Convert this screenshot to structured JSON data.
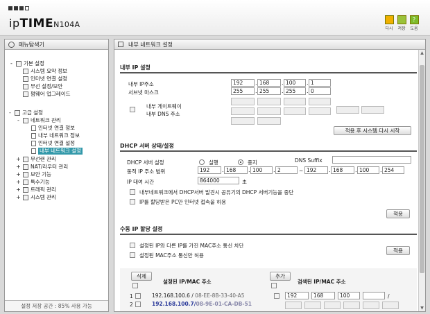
{
  "brand": {
    "prefix": "ip",
    "bold": "TIME",
    "model": "N104A"
  },
  "header_buttons": [
    {
      "label": "다시",
      "color": "#f0b000"
    },
    {
      "label": "저장",
      "color": "#9ac23a"
    },
    {
      "label": "도움",
      "color": "#7dbb2a"
    }
  ],
  "left_panel": {
    "title": "메뉴탐색기",
    "footer": "설정 저장 공간 : 85% 사용 가능",
    "tree": [
      {
        "label": "기본 설정",
        "pm": "-"
      },
      {
        "label": "시스템 요약 정보"
      },
      {
        "label": "인터넷 연결 설정"
      },
      {
        "label": "무선 설정/보안"
      },
      {
        "label": "펌웨어 업그레이드"
      },
      {
        "label": "고급 설정",
        "pm": "-"
      },
      {
        "label": "네트워크 관리",
        "pm": "-"
      },
      {
        "label": "인터넷 연결 정보"
      },
      {
        "label": "내부 네트워크 정보"
      },
      {
        "label": "인터넷 연결 설정"
      },
      {
        "label": "내부 네트워크 설정",
        "selected": true
      },
      {
        "label": "무선랜 관리",
        "pm": "+"
      },
      {
        "label": "NAT/라우터 관리",
        "pm": "+"
      },
      {
        "label": "보안 기능",
        "pm": "+"
      },
      {
        "label": "특수기능",
        "pm": "+"
      },
      {
        "label": "트래픽 관리",
        "pm": "+"
      },
      {
        "label": "시스템 관리",
        "pm": "+"
      }
    ]
  },
  "main": {
    "title": "내부 네트워크 설정",
    "ip": {
      "section": "내부 IP 설정",
      "ip_label": "내부 IP주소",
      "ip": [
        "192",
        "168",
        "100",
        "1"
      ],
      "mask_label": "서브넷 마스크",
      "mask": [
        "255",
        "255",
        "255",
        "0"
      ],
      "gw_label": "내부 게이트웨이",
      "dns_label": "내부 DNS 주소",
      "apply": "적용 후 시스템 다시 시작"
    },
    "dhcp": {
      "section": "DHCP 서버 상태/설정",
      "server_label": "DHCP 서버 설정",
      "run": "실행",
      "stop": "중지",
      "suffix_label": "DNS Suffix",
      "range_label": "동적 IP 주소 범위",
      "start": [
        "192",
        "168",
        "100",
        "2"
      ],
      "tilde": "~",
      "end": [
        "192",
        "168",
        "100",
        "254"
      ],
      "lease_label": "IP 대여 시간",
      "lease": "864000",
      "lease_unit": "초",
      "opt1": "내부네트워크에서 DHCP서버 발견시 공유기의 DHCP 서버기능을 중단",
      "opt2": "IP를 할당받은 PC만 인터넷 접속을 허용",
      "apply": "적용"
    },
    "manual": {
      "section": "수동 IP 할당 설정",
      "opt1": "설정된 IP와 다른 IP를 가진 MAC주소 통신 차단",
      "opt2": "설정된 MAC주소 통신만 허용",
      "apply": "적용",
      "delete": "삭제",
      "configured_header": "설정된 IP/MAC 주소",
      "add": "추가",
      "detected_header": "검색된 IP/MAC 주소",
      "rows": [
        {
          "no": "1",
          "ip": "192.168.100.6",
          "sep": " / ",
          "mac": "08-EE-8B-33-40-A5"
        },
        {
          "no": "2",
          "ip": "192.168.100.7",
          "sep": "/",
          "mac": "08-9E-01-CA-DB-51"
        }
      ],
      "detected": [
        "192",
        "168",
        "100",
        ""
      ],
      "slash": "/"
    }
  },
  "colors": {
    "accent": "#3399aa",
    "mac_gray": "#666666",
    "mac_blue": "#2a3a9a"
  }
}
